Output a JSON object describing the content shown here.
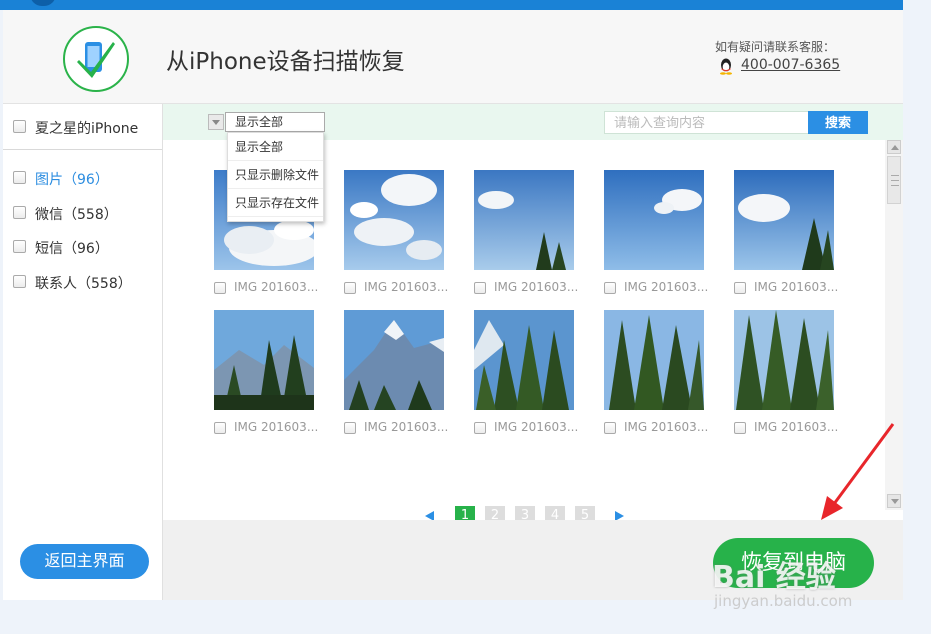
{
  "header": {
    "title": "从iPhone设备扫描恢复",
    "help_label": "如有疑问请联系客服：",
    "phone": "400-007-6365",
    "icon": "qq-icon"
  },
  "sidebar": {
    "device": "夏之星的iPhone",
    "categories": [
      {
        "label": "图片（96）",
        "active": true
      },
      {
        "label": "微信（558）",
        "active": false
      },
      {
        "label": "短信（96）",
        "active": false
      },
      {
        "label": "联系人（558）",
        "active": false
      }
    ],
    "back_button": "返回主界面"
  },
  "toolbar": {
    "filter_selected": "显示全部",
    "filter_options": [
      "显示全部",
      "只显示删除文件",
      "只显示存在文件"
    ],
    "search_placeholder": "请输入查询内容",
    "search_button": "搜索"
  },
  "photos": [
    {
      "name": "IMG 201603..."
    },
    {
      "name": "IMG 201603..."
    },
    {
      "name": "IMG 201603..."
    },
    {
      "name": "IMG 201603..."
    },
    {
      "name": "IMG 201603..."
    },
    {
      "name": "IMG 201603..."
    },
    {
      "name": "IMG 201603..."
    },
    {
      "name": "IMG 201603..."
    },
    {
      "name": "IMG 201603..."
    },
    {
      "name": "IMG 201603..."
    }
  ],
  "pagination": {
    "pages": [
      "1",
      "2",
      "3",
      "4",
      "5"
    ],
    "current": "1"
  },
  "footer": {
    "recover_button": "恢复到电脑"
  },
  "watermark": {
    "text": "Bai 经验",
    "sub": "jingyan.baidu.com"
  },
  "colors": {
    "accent_blue": "#2b8fe4",
    "accent_green": "#27b24a",
    "topbar": "#1a82d6"
  }
}
